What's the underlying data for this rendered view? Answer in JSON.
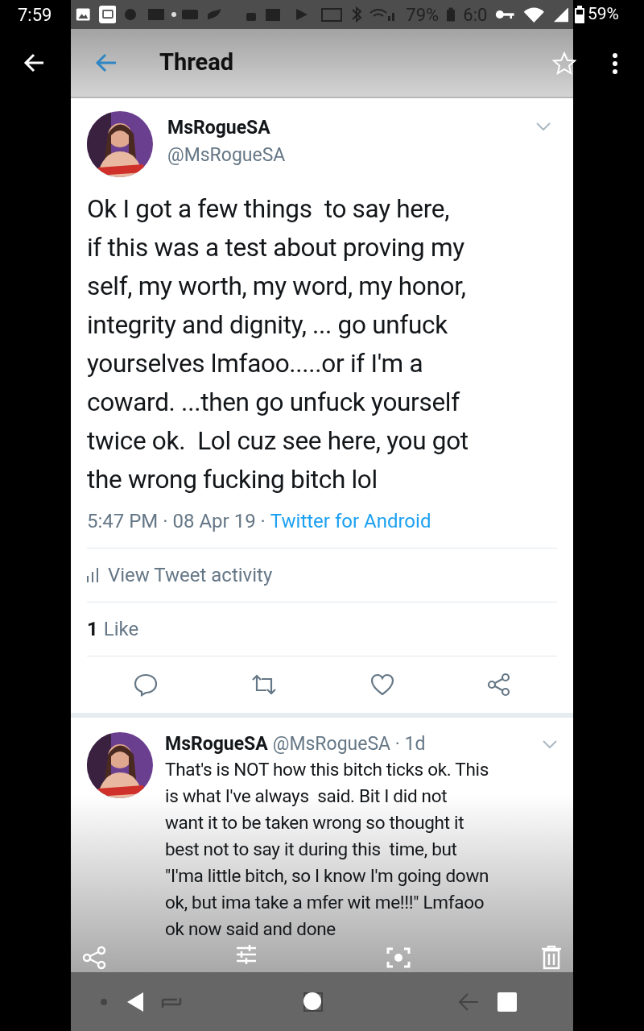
{
  "status_bar": {
    "time": "7:59",
    "battery": "59%"
  },
  "inner_status_bar": {
    "battery": "79%",
    "time": "6:0"
  },
  "app_bar": {
    "title": "Thread"
  },
  "tweet": {
    "name": "MsRogueSA",
    "handle": "@MsRogueSA",
    "text": "Ok I got a few things  to say here,\nif this was a test about proving my\nself, my worth, my word, my honor,\nintegrity and dignity, ... go unfuck\nyourselves lmfaoo.....or if I'm a\ncoward. ...then go unfuck yourself\ntwice ok.  Lol cuz see here, you got\nthe wrong fucking bitch lol",
    "timestamp": "5:47 PM · 08 Apr 19 ·",
    "source": "Twitter for Android",
    "activity": "View Tweet activity",
    "like_count": "1",
    "like_label": "Like"
  },
  "reply": {
    "name": "MsRogueSA",
    "handle": "@MsRogueSA · 1d",
    "text": "That's is NOT how this bitch ticks ok. This\nis what I've always  said. Bit I did not\nwant it to be taken wrong so thought it\nbest not to say it during this  time, but\n\"I'ma little bitch, so I know I'm going down\nok, but ima take a mfer wit me!!!\" Lmfaoo\nok now said and done"
  }
}
